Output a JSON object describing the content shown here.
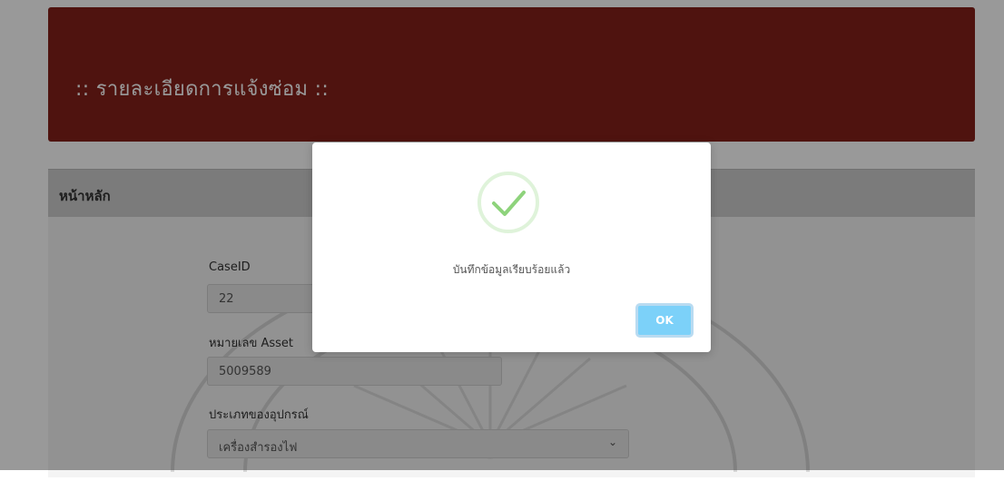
{
  "colors": {
    "header_bg": "#84201a",
    "primary_button": "#7cd1f9",
    "success_green": "#8ed37c",
    "success_ring": "#dff3da"
  },
  "header": {
    "title": ":: รายละเอียดการแจ้งซ่อม ::"
  },
  "panel": {
    "heading": "หน้าหลัก"
  },
  "form": {
    "case_id": {
      "label": "CaseID",
      "value": "22"
    },
    "asset_no": {
      "label": "หมายเลข Asset",
      "value": "5009589"
    },
    "device_type": {
      "label": "ประเภทของอุปกรณ์",
      "value": "เครื่องสำรองไฟ",
      "chevron_icon": "chevron-down-icon"
    }
  },
  "modal": {
    "icon": "success-check-icon",
    "message": "บันทึกข้อมูลเรียบร้อยแล้ว",
    "ok_label": "OK"
  }
}
